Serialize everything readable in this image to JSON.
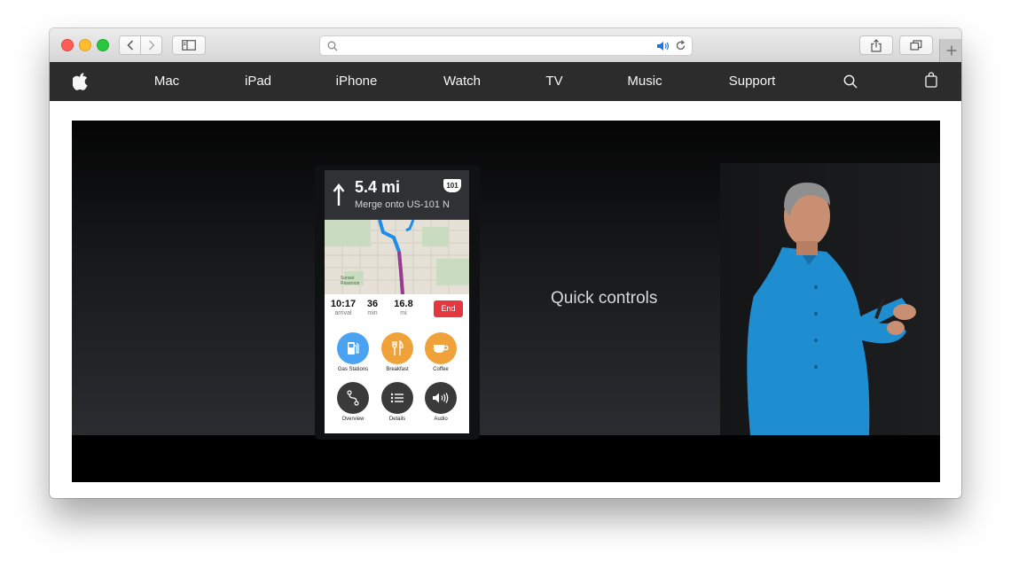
{
  "browser": {
    "address_value": "",
    "colors": {
      "close": "#ff5f57",
      "minimize": "#ffbd2e",
      "zoom": "#28c840"
    }
  },
  "nav": {
    "items": [
      "Mac",
      "iPad",
      "iPhone",
      "Watch",
      "TV",
      "Music",
      "Support"
    ],
    "icons": [
      "apple-logo",
      "search-icon",
      "bag-icon"
    ]
  },
  "slide": {
    "caption": "Quick controls",
    "phone": {
      "distance": "5.4 mi",
      "instruction": "Merge onto US-101 N",
      "route_shield": "101",
      "map_label": "Sunset Reservoir",
      "stats": [
        {
          "value": "10:17",
          "label": "arrival"
        },
        {
          "value": "36",
          "label": "min"
        },
        {
          "value": "16.8",
          "label": "mi"
        }
      ],
      "end_label": "End",
      "quick_actions": [
        {
          "label": "Gas Stations",
          "color": "#4aa3f0",
          "icon": "gas-icon"
        },
        {
          "label": "Breakfast",
          "color": "#f0a23a",
          "icon": "fork-knife-icon"
        },
        {
          "label": "Coffee",
          "color": "#f0a23a",
          "icon": "coffee-icon"
        },
        {
          "label": "Overview",
          "color": "#3a3a3a",
          "icon": "route-icon"
        },
        {
          "label": "Details",
          "color": "#3a3a3a",
          "icon": "list-icon"
        },
        {
          "label": "Audio",
          "color": "#3a3a3a",
          "icon": "speaker-icon"
        }
      ]
    }
  }
}
